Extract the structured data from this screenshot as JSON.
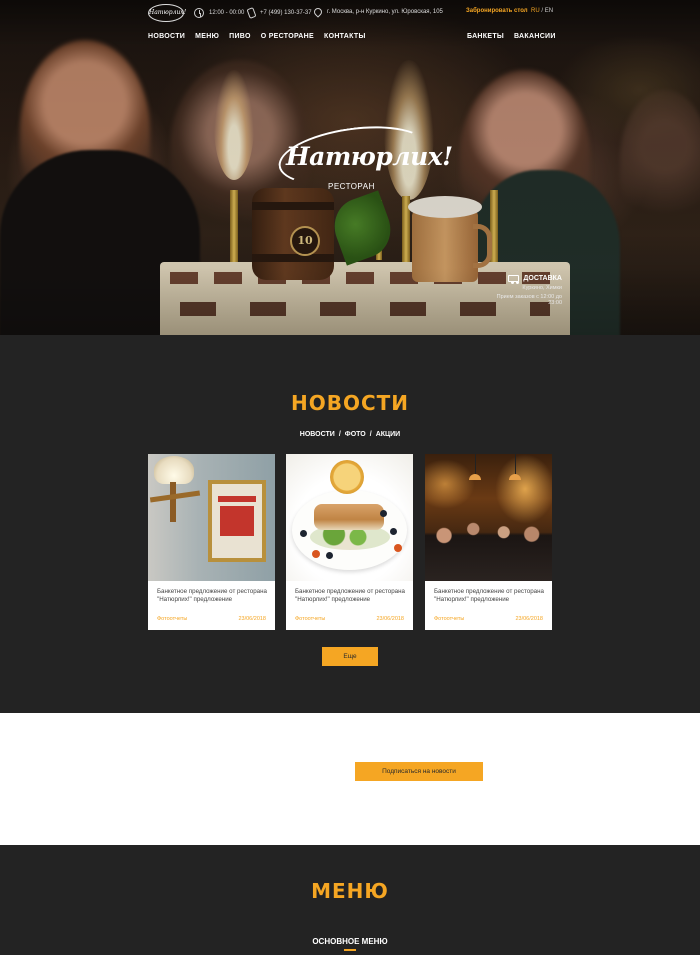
{
  "colors": {
    "accent": "#f5a623",
    "dark_bg": "#232323",
    "white": "#ffffff"
  },
  "topbar": {
    "logo_small": "Натюрлих!",
    "hours": "12:00 - 00:00",
    "phone": "+7 (499) 130-37-37",
    "address": "г. Москва, р-н Куркино, ул. Юровская, 105",
    "book_table": "Забронировать стол",
    "lang_ru": "RU",
    "lang_sep": "/",
    "lang_en": "EN"
  },
  "nav": {
    "left": [
      "НОВОСТИ",
      "МЕНЮ",
      "ПИВО",
      "О РЕСТОРАНЕ",
      "КОНТАКТЫ"
    ],
    "right": [
      "БАНКЕТЫ",
      "ВАКАНСИИ"
    ]
  },
  "hero": {
    "logo_name": "Натюрлих!",
    "logo_sub": "РЕСТОРАН",
    "cake_number": "10",
    "delivery_title": "ДОСТАВКА",
    "delivery_area": "Куркино, Химки",
    "delivery_hours": "Прием заказов с 12:00 до 23:00"
  },
  "news": {
    "title": "НОВОСТИ",
    "filters": [
      "НОВОСТИ",
      "ФОТО",
      "АКЦИИ"
    ],
    "filter_sep": "/",
    "cards": [
      {
        "title": "Банкетное предложение от ресторана \"Натюрлих!\" предложение",
        "category": "Фотоотчеты",
        "date": "23/06/2018"
      },
      {
        "title": "Банкетное предложение от ресторана \"Натюрлих!\" предложение",
        "category": "Фотоотчеты",
        "date": "23/06/2018"
      },
      {
        "title": "Банкетное предложение от ресторана \"Натюрлих!\" предложение",
        "category": "Фотоотчеты",
        "date": "23/06/2018"
      }
    ],
    "more_label": "Еще"
  },
  "subscribe": {
    "label": "Подписаться на новости"
  },
  "menu": {
    "title": "МЕНЮ",
    "tab": "ОСНОВНОЕ МЕНЮ"
  }
}
